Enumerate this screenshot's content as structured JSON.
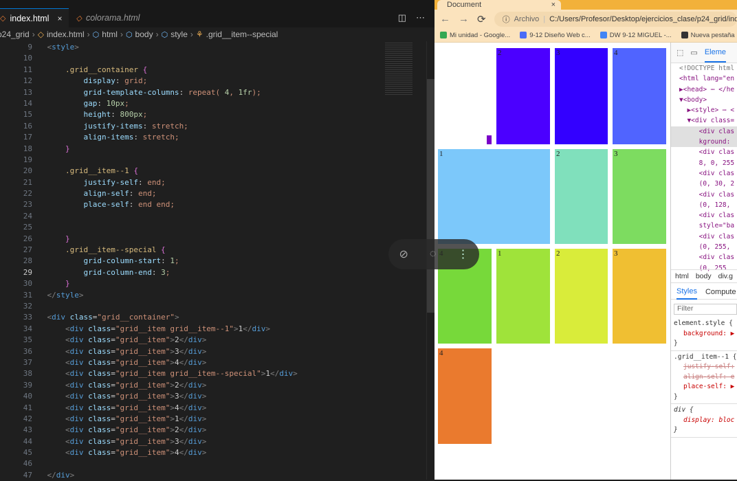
{
  "editor": {
    "tabs": [
      {
        "label": "index.html",
        "active": true
      },
      {
        "label": "colorama.html",
        "active": false
      }
    ],
    "tab_close": "×",
    "breadcrumb": [
      "p24_grid",
      "index.html",
      "html",
      "body",
      "style",
      ".grid__item--special"
    ],
    "current_line": 29,
    "lines": [
      {
        "n": 9,
        "t": "    <style>"
      },
      {
        "n": 10,
        "t": ""
      },
      {
        "n": 11,
        "t": "        .grid__container {"
      },
      {
        "n": 12,
        "t": "            display: grid;"
      },
      {
        "n": 13,
        "t": "            grid-template-columns: repeat( 4, 1fr);"
      },
      {
        "n": 14,
        "t": "            gap: 10px;"
      },
      {
        "n": 15,
        "t": "            height: 800px;"
      },
      {
        "n": 16,
        "t": "            justify-items: stretch;"
      },
      {
        "n": 17,
        "t": "            align-items: stretch;"
      },
      {
        "n": 18,
        "t": "        }"
      },
      {
        "n": 19,
        "t": ""
      },
      {
        "n": 20,
        "t": "        .grid__item--1 {"
      },
      {
        "n": 21,
        "t": "            justify-self: end;"
      },
      {
        "n": 22,
        "t": "            align-self: end;"
      },
      {
        "n": 23,
        "t": "            place-self: end end;"
      },
      {
        "n": 24,
        "t": ""
      },
      {
        "n": 25,
        "t": ""
      },
      {
        "n": 26,
        "t": "        }"
      },
      {
        "n": 27,
        "t": "        .grid__item--special {"
      },
      {
        "n": 28,
        "t": "            grid-column-start: 1;"
      },
      {
        "n": 29,
        "t": "            grid-column-end: 3;"
      },
      {
        "n": 30,
        "t": "        }"
      },
      {
        "n": 31,
        "t": "    </style>"
      },
      {
        "n": 32,
        "t": ""
      },
      {
        "n": 33,
        "t": "    <div class=\"grid__container\">"
      },
      {
        "n": 34,
        "t": "        <div class=\"grid__item grid__item--1\">1</div>"
      },
      {
        "n": 35,
        "t": "        <div class=\"grid__item\">2</div>"
      },
      {
        "n": 36,
        "t": "        <div class=\"grid__item\">3</div>"
      },
      {
        "n": 37,
        "t": "        <div class=\"grid__item\">4</div>"
      },
      {
        "n": 38,
        "t": "        <div class=\"grid__item grid__item--special\">1</div>"
      },
      {
        "n": 39,
        "t": "        <div class=\"grid__item\">2</div>"
      },
      {
        "n": 40,
        "t": "        <div class=\"grid__item\">3</div>"
      },
      {
        "n": 41,
        "t": "        <div class=\"grid__item\">4</div>"
      },
      {
        "n": 42,
        "t": "        <div class=\"grid__item\">1</div>"
      },
      {
        "n": 43,
        "t": "        <div class=\"grid__item\">2</div>"
      },
      {
        "n": 44,
        "t": "        <div class=\"grid__item\">3</div>"
      },
      {
        "n": 45,
        "t": "        <div class=\"grid__item\">4</div>"
      },
      {
        "n": 46,
        "t": ""
      },
      {
        "n": 47,
        "t": "    </div>"
      }
    ]
  },
  "browser": {
    "tab_title": "Document",
    "tab_close": "×",
    "url_scheme": "Archivo",
    "url": "C:/Users/Profesor/Desktop/ejercicios_clase/p24_grid/index.html",
    "bookmarks": [
      {
        "label": "Mi unidad - Google...",
        "color": "#34a853"
      },
      {
        "label": "9-12 Diseño Web c...",
        "color": "#4a6cf7"
      },
      {
        "label": "DW 9-12 MIGUEL -...",
        "color": "#4285f4"
      },
      {
        "label": "Nueva pestaña",
        "color": "#333333"
      }
    ],
    "grid_items": [
      {
        "label": "1",
        "color": "#7a00c8"
      },
      {
        "label": "2",
        "color": "#4b00ff"
      },
      {
        "label": "3",
        "color": "#3300ff"
      },
      {
        "label": "4",
        "color": "#5064ff"
      },
      {
        "label": "1",
        "color": "#7cc8fa"
      },
      {
        "label": "2",
        "color": "#80e0bc"
      },
      {
        "label": "3",
        "color": "#7ddc60"
      },
      {
        "label": "4",
        "color": "#77d93a"
      },
      {
        "label": "1",
        "color": "#9fe33a"
      },
      {
        "label": "2",
        "color": "#d9ec3a"
      },
      {
        "label": "3",
        "color": "#f0bf32"
      },
      {
        "label": "4",
        "color": "#ea7a2e"
      }
    ]
  },
  "devtools": {
    "tab_elements": "Eleme",
    "dom_lines": [
      "<!DOCTYPE html",
      "<html lang=\"en",
      "▶<head> ⋯ </he",
      "▼<body>",
      "  ▶<style> ⋯ <",
      "  ▼<div class=",
      "     <div clas",
      "     kground:",
      "     <div clas",
      "     8, 0, 255",
      "     <div clas",
      "     (0, 30, 2",
      "     <div clas",
      "     (0, 128,",
      "     <div clas",
      "     style=\"ba",
      "     <div clas",
      "     (0, 255,",
      "     <div clas",
      "     (0, 255"
    ],
    "crumbs": [
      "html",
      "body",
      "div.g"
    ],
    "style_tabs": [
      "Styles",
      "Compute"
    ],
    "filter_placeholder": "Filter",
    "rules": {
      "r1_sel": "element.style {",
      "r1_p1": "background: ▶",
      "r2_sel": ".grid__item--1 {",
      "r2_p1": "justify-self:",
      "r2_p2": "align-self: e",
      "r2_p3": "place-self: ▶",
      "r3_sel": "div {",
      "r3_p1": "display: bloc",
      "close": "}"
    }
  }
}
